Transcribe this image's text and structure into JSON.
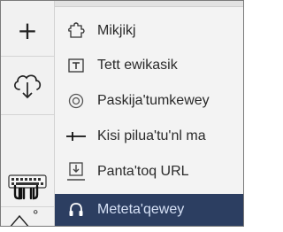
{
  "toolbar": {
    "buttons": [
      {
        "name": "add",
        "icon": "plus-icon",
        "label": "+"
      },
      {
        "name": "cloud-download",
        "icon": "cloud-download-icon"
      },
      {
        "name": "keyboard-input",
        "icon": "keyboard-icon"
      },
      {
        "name": "shapes",
        "icon": "triangle-circle-icon",
        "label": "°"
      }
    ]
  },
  "menu": {
    "items": [
      {
        "label": "Mikjikj",
        "icon": "puzzle-icon",
        "selected": false
      },
      {
        "label": "Tett ewikasik",
        "icon": "text-box-icon",
        "selected": false
      },
      {
        "label": "Paskija'tumkewey",
        "icon": "target-icon",
        "selected": false
      },
      {
        "label": "Kisi pilua'tu'nl ma",
        "icon": "divider-line-icon",
        "selected": false
      },
      {
        "label": "Panta'toq URL",
        "icon": "download-tray-icon",
        "selected": false
      },
      {
        "label": "Meteta'qewey",
        "icon": "headphones-icon",
        "selected": true
      }
    ],
    "colors": {
      "selected_background": "#2c3e61",
      "selected_text": "#d6e1f6",
      "text": "#2a2a2a"
    }
  }
}
